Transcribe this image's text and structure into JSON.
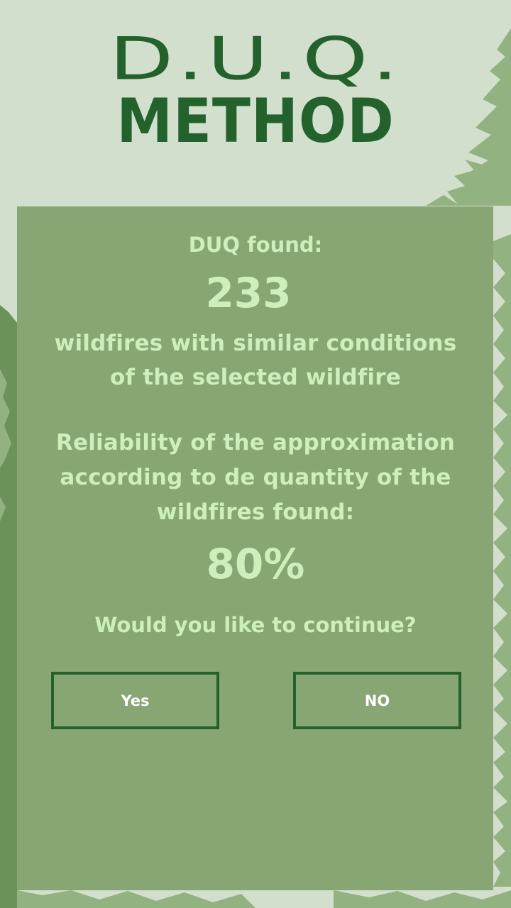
{
  "logo": {
    "line1": "D.U.Q.",
    "line2": "METHOD"
  },
  "result": {
    "found_label": "DUQ found:",
    "found_count": "233",
    "description": "wildfires with similar conditions\nof the selected wildfire",
    "reliability_label": "Reliability of the approximation\naccording to de quantity of the\nwildfires found:",
    "reliability_value": "80%",
    "question": "Would you like to continue?"
  },
  "buttons": {
    "yes_label": "Yes",
    "no_label": "NO"
  },
  "colors": {
    "background": "#d1dfcc",
    "panel": "#88a574",
    "logo": "#23622c",
    "text": "#cdeebd",
    "button_border": "#23622c",
    "tree_dark": "#6b9259",
    "tree_light": "#93b281"
  }
}
